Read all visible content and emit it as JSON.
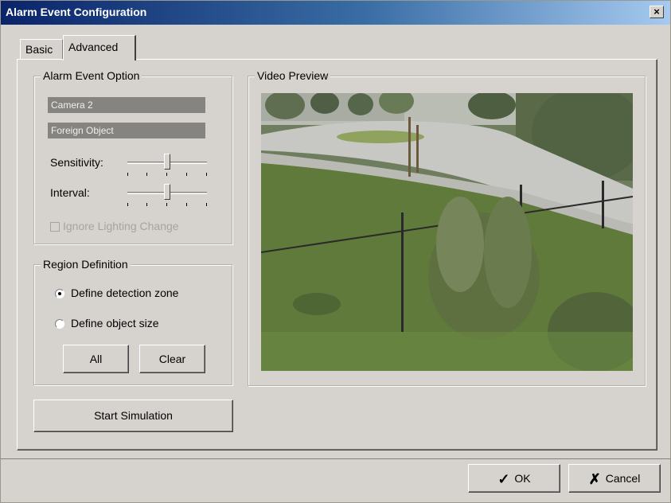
{
  "window": {
    "title": "Alarm Event Configuration",
    "close_label": "×"
  },
  "tabs": [
    {
      "label": "Basic",
      "selected": false
    },
    {
      "label": "Advanced",
      "selected": true
    }
  ],
  "alarm_event_option": {
    "group_label": "Alarm Event Option",
    "camera": "Camera 2",
    "event_type": "Foreign Object",
    "sensitivity_label": "Sensitivity:",
    "sensitivity_value": 0.5,
    "interval_label": "Interval:",
    "interval_value": 0.5,
    "ignore_lighting_label": "Ignore Lighting Change",
    "ignore_lighting_checked": false,
    "ignore_lighting_enabled": false
  },
  "region_definition": {
    "group_label": "Region Definition",
    "options": [
      {
        "label": "Define detection zone",
        "checked": true
      },
      {
        "label": "Define object size",
        "checked": false
      }
    ],
    "all_label": "All",
    "clear_label": "Clear"
  },
  "start_simulation_label": "Start Simulation",
  "video_preview": {
    "group_label": "Video Preview"
  },
  "footer": {
    "ok_icon": "✓",
    "ok_label": "OK",
    "cancel_icon": "✗",
    "cancel_label": "Cancel"
  },
  "colors": {
    "window_bg": "#d6d3ce",
    "titlebar": "#0a246a",
    "disabled_field": "#868480"
  }
}
